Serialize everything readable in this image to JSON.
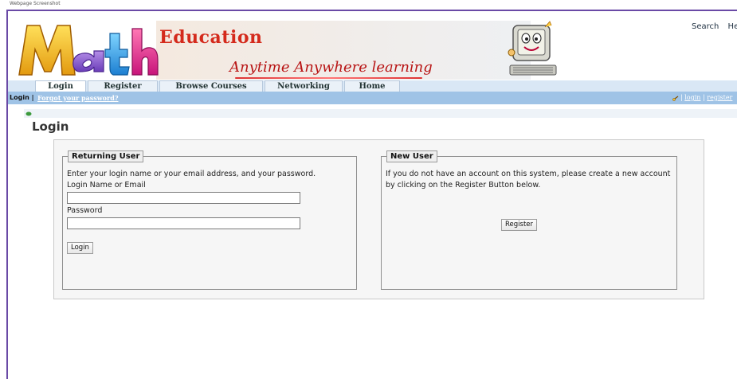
{
  "caption": "Webpage Screenshot",
  "header": {
    "logo_text": "Math",
    "brand": "Education",
    "tagline": "Anytime Anywhere learning",
    "top_links": [
      "Search",
      "Help"
    ]
  },
  "tabs": [
    {
      "label": "Login",
      "active": true
    },
    {
      "label": "Register",
      "active": false
    },
    {
      "label": "Browse Courses",
      "active": false
    },
    {
      "label": "Networking",
      "active": false
    },
    {
      "label": "Home",
      "active": false
    }
  ],
  "subnav": {
    "current": "Login",
    "separator": "|",
    "forgot": "Forgot your password?",
    "right_login": "login",
    "right_register": "register"
  },
  "page": {
    "title": "Login"
  },
  "returning_user": {
    "legend": "Returning User",
    "instructions": "Enter your login name or your email address, and your password.",
    "login_label": "Login Name or Email",
    "login_value": "",
    "password_label": "Password",
    "password_value": "",
    "button": "Login"
  },
  "new_user": {
    "legend": "New User",
    "line1": "If you do not have an account on this system, please create a new account",
    "line2": "by clicking on the Register Button below.",
    "button": "Register"
  },
  "colors": {
    "brand_red": "#d42a1c",
    "tab_bar": "#d9e7f5",
    "subnav": "#9fc3e6",
    "frame": "#6a4aa6"
  },
  "icons": [
    "math-logo",
    "computer-mascot-icon",
    "key-icon",
    "leaf-icon"
  ]
}
